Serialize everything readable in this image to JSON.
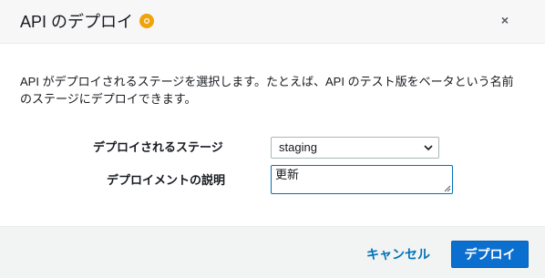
{
  "header": {
    "title": "API のデプロイ",
    "close_symbol": "×",
    "info_icon": "info-icon"
  },
  "body": {
    "description": "API がデプロイされるステージを選択します。たとえば、API のテスト版をベータという名前のステージにデプロイできます。",
    "stage_label": "デプロイされるステージ",
    "stage_selected": "staging",
    "description_label": "デプロイメントの説明",
    "description_value": "更新"
  },
  "footer": {
    "cancel_label": "キャンセル",
    "deploy_label": "デプロイ"
  },
  "colors": {
    "accent": "#0073bb",
    "primary_button": "#0b6fcf",
    "info_icon": "#f0a30a"
  }
}
